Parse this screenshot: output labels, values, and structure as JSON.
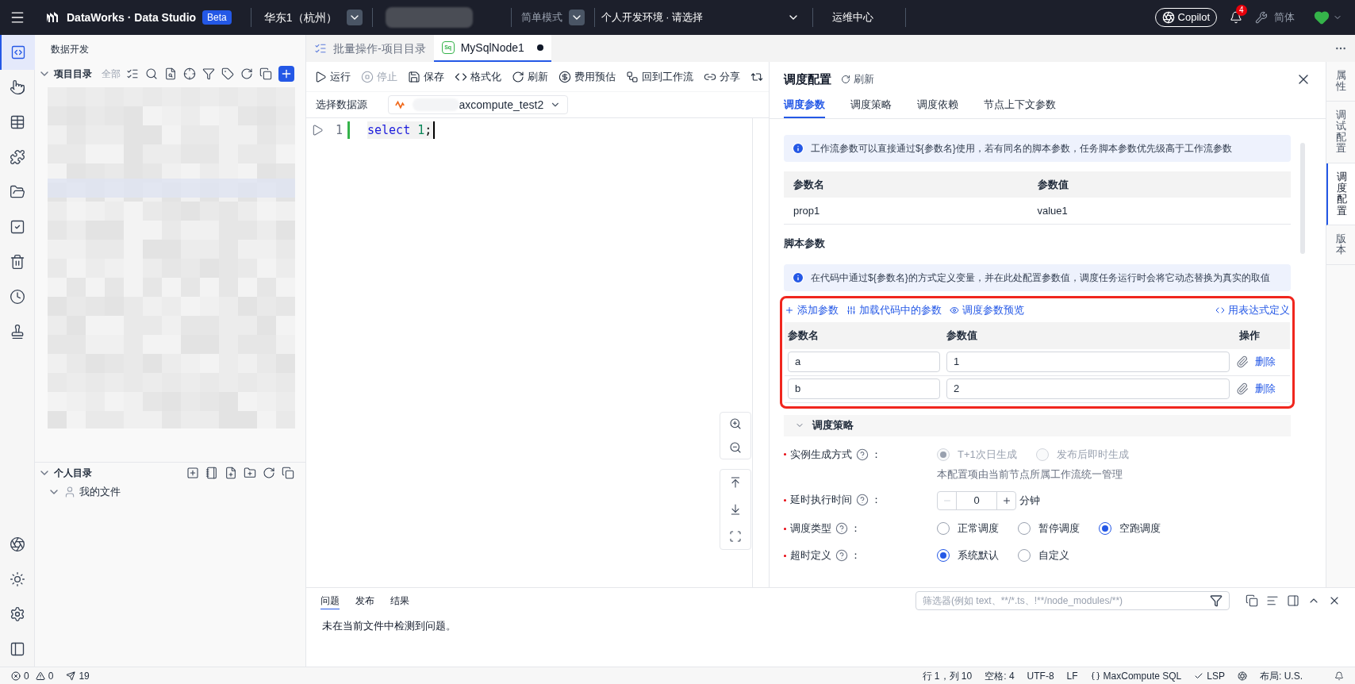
{
  "topbar": {
    "brand": "DataWorks · Data Studio",
    "badge": "Beta",
    "region": "华东1（杭州）",
    "mode": "简单模式",
    "env": "个人开发环境 · 请选择",
    "ops": "运维中心",
    "copilot": "Copilot",
    "notifications": "4",
    "lang": "简体"
  },
  "activity_bar": {
    "top": [
      {
        "kind": "code",
        "selected": true
      },
      {
        "kind": "pointer",
        "selected": false
      },
      {
        "kind": "table",
        "selected": false
      },
      {
        "kind": "puzzle",
        "selected": false
      },
      {
        "kind": "folder",
        "selected": false
      },
      {
        "kind": "task",
        "selected": false
      },
      {
        "kind": "trash",
        "selected": false
      },
      {
        "kind": "clock",
        "selected": false
      },
      {
        "kind": "stamp",
        "selected": false
      }
    ],
    "bottom": [
      {
        "kind": "logo",
        "selected": false
      },
      {
        "kind": "sun",
        "selected": false
      },
      {
        "kind": "settings",
        "selected": false
      },
      {
        "kind": "panel",
        "selected": false
      }
    ]
  },
  "sidebar": {
    "title": "数据开发",
    "project": {
      "label": "项目目录",
      "filter": "全部",
      "expanded": true
    },
    "personal": {
      "label": "个人目录",
      "expanded": true,
      "children": [
        {
          "label": "我的文件",
          "expanded": true
        }
      ]
    }
  },
  "editor_tabs": [
    {
      "label": "批量操作-项目目录",
      "kind": "batch",
      "selected": false,
      "modified": false
    },
    {
      "label": "MySqlNode1",
      "kind": "sql",
      "icon_text": "Sq",
      "selected": true,
      "modified": true
    }
  ],
  "toolbar": [
    {
      "label": "运行",
      "kind": "run",
      "disabled": false
    },
    {
      "label": "停止",
      "kind": "stop",
      "disabled": true
    },
    {
      "label": "保存",
      "kind": "save",
      "disabled": false
    },
    {
      "label": "格式化",
      "kind": "format",
      "disabled": false
    },
    {
      "label": "刷新",
      "kind": "refresh",
      "disabled": false
    },
    {
      "label": "费用预估",
      "kind": "cost",
      "disabled": false
    },
    {
      "label": "回到工作流",
      "kind": "workflow",
      "disabled": false
    },
    {
      "label": "分享",
      "kind": "share",
      "disabled": false
    }
  ],
  "datasource": {
    "label": "选择数据源",
    "value": "axcompute_test2"
  },
  "code": [
    {
      "number": "1",
      "tokens": [
        {
          "text": "select",
          "kind": "keyword"
        },
        {
          "text": "1",
          "kind": "number",
          "space_before": true
        },
        {
          "text": ";",
          "kind": "plain"
        }
      ]
    }
  ],
  "config_panel": {
    "title": "调度配置",
    "refresh": "刷新",
    "tabs": [
      {
        "label": "调度参数",
        "selected": true
      },
      {
        "label": "调度策略",
        "selected": false
      },
      {
        "label": "调度依赖",
        "selected": false
      },
      {
        "label": "节点上下文参数",
        "selected": false
      }
    ],
    "workflow_notice": "工作流参数可以直接通过${参数名}使用，若有同名的脚本参数，任务脚本参数优先级高于工作流参数",
    "workflow_table": {
      "columns": [
        "参数名",
        "参数值"
      ],
      "rows": [
        [
          "prop1",
          "value1"
        ]
      ]
    },
    "script_title": "脚本参数",
    "script_notice": "在代码中通过${参数名}的方式定义变量，并在此处配置参数值，调度任务运行时会将它动态替换为真实的取值",
    "actions": [
      {
        "label": "添加参数",
        "kind": "add"
      },
      {
        "label": "加载代码中的参数",
        "kind": "load"
      },
      {
        "label": "调度参数预览",
        "kind": "preview"
      }
    ],
    "expression_link": "用表达式定义",
    "script_table": {
      "columns": [
        "参数名",
        "参数值",
        "操作"
      ],
      "rows": [
        {
          "name": "a",
          "value": "1",
          "action": "删除"
        },
        {
          "name": "b",
          "value": "2",
          "action": "删除"
        }
      ]
    },
    "strategy": {
      "title": "调度策略",
      "expanded": true,
      "label_suffix": "：",
      "fields": [
        {
          "label": "实例生成方式",
          "kind": "radio",
          "required": true,
          "disabled": true,
          "options": [
            {
              "label": "T+1次日生成",
              "selected": true
            },
            {
              "label": "发布后即时生成",
              "selected": false
            }
          ],
          "note": "本配置项由当前节点所属工作流统一管理"
        },
        {
          "label": "延时执行时间",
          "kind": "stepper",
          "required": true,
          "value": "0",
          "unit": "分钟"
        },
        {
          "label": "调度类型",
          "kind": "radio",
          "required": true,
          "disabled": false,
          "options": [
            {
              "label": "正常调度",
              "selected": false
            },
            {
              "label": "暂停调度",
              "selected": false
            },
            {
              "label": "空跑调度",
              "selected": true
            }
          ]
        },
        {
          "label": "超时定义",
          "kind": "radio",
          "required": true,
          "disabled": false,
          "options": [
            {
              "label": "系统默认",
              "selected": true
            },
            {
              "label": "自定义",
              "selected": false
            }
          ]
        }
      ]
    }
  },
  "right_rail": [
    {
      "label": "属性",
      "selected": false
    },
    {
      "label": "调试配置",
      "selected": false
    },
    {
      "label": "调度配置",
      "selected": true
    },
    {
      "label": "版本",
      "selected": false
    }
  ],
  "bottom_panel": {
    "tabs": [
      {
        "label": "问题",
        "selected": true
      },
      {
        "label": "发布",
        "selected": false
      },
      {
        "label": "结果",
        "selected": false
      }
    ],
    "filter_placeholder": "筛选器(例如 text、**/*.ts、!**/node_modules/**)",
    "message": "未在当前文件中检测到问题。"
  },
  "status_bar": {
    "errors": "0",
    "warnings": "0",
    "sends": "19",
    "position": "行 1，列 10",
    "spaces": "空格: 4",
    "encoding": "UTF-8",
    "eol": "LF",
    "language": "MaxCompute SQL",
    "lsp": "LSP",
    "layout": "布局: U.S."
  }
}
